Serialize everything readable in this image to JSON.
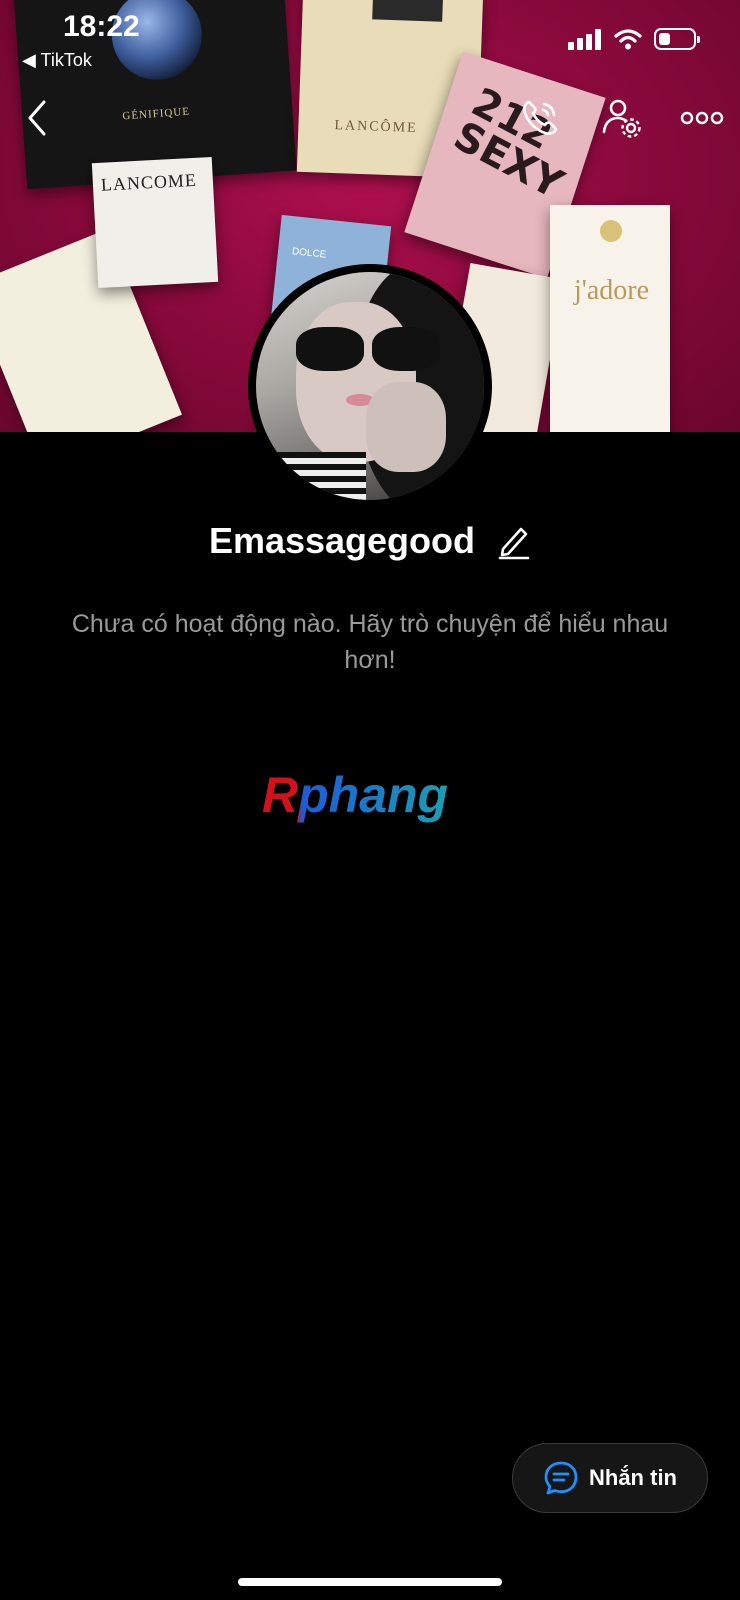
{
  "status_bar": {
    "time": "18:22",
    "back_app": "◀ TikTok",
    "signal_icon": "cellular-signal-icon",
    "wifi_icon": "wifi-icon",
    "battery_icon": "battery-icon",
    "battery_level": 0.35
  },
  "cover": {
    "box_labels": {
      "dark": "GÉNIFIQUE",
      "gold": "LANCÔME",
      "pink": "212 SEXY",
      "white": "LANCOME",
      "blue": "DOLCE",
      "jadore": "j'adore"
    }
  },
  "nav": {
    "back_icon": "back-chevron-icon",
    "call_icon": "phone-icon",
    "profile_settings_icon": "profile-settings-icon",
    "more_icon": "more-dots-icon"
  },
  "profile": {
    "name": "Emassagegood",
    "edit_icon": "pencil-icon",
    "empty_message": "Chưa có hoạt động nào. Hãy trò chuyện để hiểu nhau hơn!"
  },
  "watermark": {
    "text": "Rphang",
    "colors": {
      "red": "#d1121b",
      "blue": "#1e5bd6",
      "teal": "#1b9fb3"
    }
  },
  "message_button": {
    "label": "Nhắn tin",
    "icon": "chat-bubble-icon",
    "accent": "#1e90ff"
  }
}
